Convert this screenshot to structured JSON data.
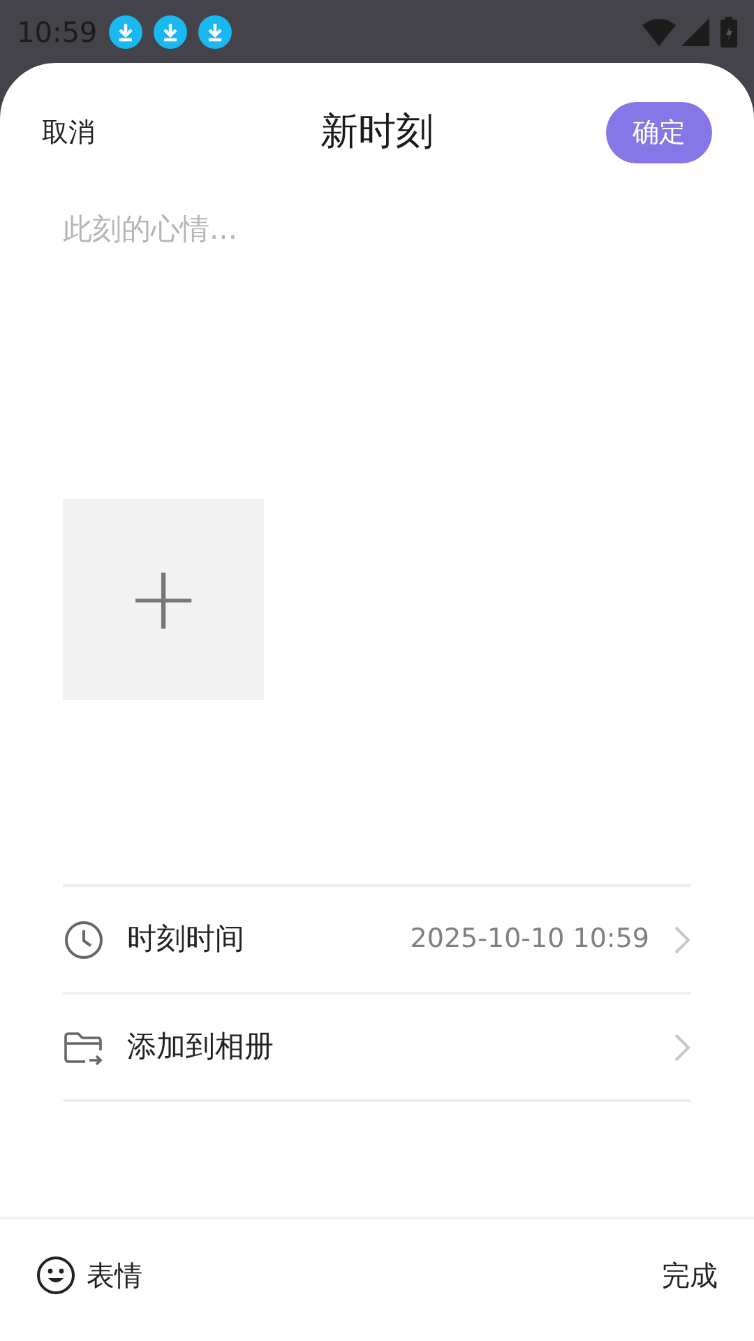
{
  "status_bar": {
    "time": "10:59",
    "notifications": [
      {
        "kind": "download"
      },
      {
        "kind": "download"
      },
      {
        "kind": "download"
      }
    ]
  },
  "header": {
    "cancel": "取消",
    "title": "新时刻",
    "confirm": "确定"
  },
  "mood_field": {
    "placeholder": "此刻的心情..."
  },
  "photo_add": {
    "label": "+"
  },
  "options": [
    {
      "kind": "time",
      "label": "时刻时间",
      "value": "2025-10-10 10:59"
    },
    {
      "kind": "album",
      "label": "添加到相册"
    }
  ],
  "bottom_bar": {
    "emoji": "表情",
    "done": "完成"
  }
}
